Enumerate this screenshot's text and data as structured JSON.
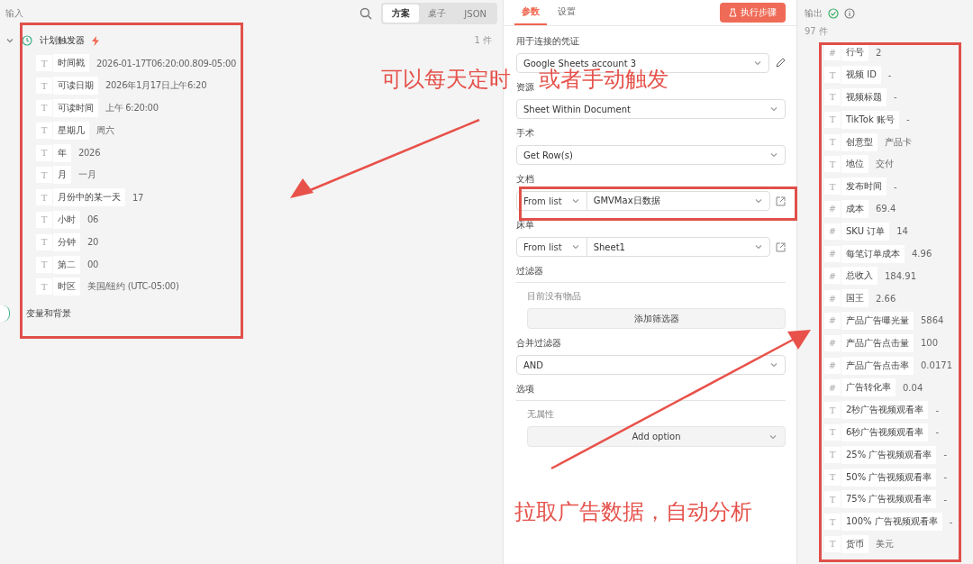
{
  "input_panel": {
    "title": "输入",
    "view_tabs": [
      {
        "label": "方案",
        "selected": true
      },
      {
        "label": "桌子",
        "selected": false
      },
      {
        "label": "JSON",
        "selected": false
      }
    ],
    "node": {
      "name": "计划触发器",
      "expanded": true,
      "count": "1 件",
      "fields": [
        {
          "glyph": "T",
          "key": "时间戳",
          "value": "2026-01-17T06:20:00.809-05:00"
        },
        {
          "glyph": "T",
          "key": "可读日期",
          "value": "2026年1月17日上午6:20"
        },
        {
          "glyph": "T",
          "key": "可读时间",
          "value": "上午 6:20:00"
        },
        {
          "glyph": "T",
          "key": "星期几",
          "value": "周六"
        },
        {
          "glyph": "T",
          "key": "年",
          "value": "2026"
        },
        {
          "glyph": "T",
          "key": "月",
          "value": "一月"
        },
        {
          "glyph": "T",
          "key": "月份中的某一天",
          "value": "17"
        },
        {
          "glyph": "T",
          "key": "小时",
          "value": "06"
        },
        {
          "glyph": "T",
          "key": "分钟",
          "value": "20"
        },
        {
          "glyph": "T",
          "key": "第二",
          "value": "00"
        },
        {
          "glyph": "T",
          "key": "时区",
          "value": "美国/纽约 (UTC-05:00)"
        }
      ]
    },
    "section": "变量和背景"
  },
  "params_panel": {
    "tabs": [
      {
        "label": "参数",
        "selected": true
      },
      {
        "label": "设置",
        "selected": false
      }
    ],
    "run_button": "执行步骤",
    "fields": [
      {
        "kind": "select",
        "label": "用于连接的凭证",
        "value": "Google Sheets account 3",
        "edit": true
      },
      {
        "kind": "select",
        "label": "资源",
        "value": "Sheet Within Document"
      },
      {
        "kind": "select",
        "label": "手术",
        "value": "Get Row(s)"
      },
      {
        "kind": "locator",
        "label": "文档",
        "mode": "From list",
        "value": "GMVMax日数据"
      },
      {
        "kind": "locator",
        "label": "床单",
        "mode": "From list",
        "value": "Sheet1"
      },
      {
        "kind": "collection",
        "label": "过滤器",
        "empty": "目前没有物品",
        "button": "添加筛选器"
      },
      {
        "kind": "select",
        "label": "合并过滤器",
        "value": "AND"
      },
      {
        "kind": "options",
        "label": "选项",
        "empty": "无属性",
        "button": "Add option"
      }
    ]
  },
  "output_panel": {
    "title": "输出",
    "count": "97 件",
    "fields": [
      {
        "glyph": "#",
        "key": "行号",
        "value": "2"
      },
      {
        "glyph": "T",
        "key": "视频 ID",
        "value": "-"
      },
      {
        "glyph": "T",
        "key": "视频标题",
        "value": "-"
      },
      {
        "glyph": "T",
        "key": "TikTok 账号",
        "value": "-"
      },
      {
        "glyph": "T",
        "key": "创意型",
        "value": "产品卡"
      },
      {
        "glyph": "T",
        "key": "地位",
        "value": "交付"
      },
      {
        "glyph": "T",
        "key": "发布时间",
        "value": "-"
      },
      {
        "glyph": "#",
        "key": "成本",
        "value": "69.4"
      },
      {
        "glyph": "#",
        "key": "SKU 订单",
        "value": "14"
      },
      {
        "glyph": "#",
        "key": "每笔订单成本",
        "value": "4.96"
      },
      {
        "glyph": "#",
        "key": "总收入",
        "value": "184.91"
      },
      {
        "glyph": "#",
        "key": "国王",
        "value": "2.66"
      },
      {
        "glyph": "#",
        "key": "产品广告曝光量",
        "value": "5864"
      },
      {
        "glyph": "#",
        "key": "产品广告点击量",
        "value": "100"
      },
      {
        "glyph": "#",
        "key": "产品广告点击率",
        "value": "0.0171"
      },
      {
        "glyph": "#",
        "key": "广告转化率",
        "value": "0.04"
      },
      {
        "glyph": "T",
        "key": "2秒广告视频观看率",
        "value": "-"
      },
      {
        "glyph": "T",
        "key": "6秒广告视频观看率",
        "value": "-"
      },
      {
        "glyph": "T",
        "key": "25% 广告视频观看率",
        "value": "-"
      },
      {
        "glyph": "T",
        "key": "50% 广告视频观看率",
        "value": "-"
      },
      {
        "glyph": "T",
        "key": "75% 广告视频观看率",
        "value": "-"
      },
      {
        "glyph": "T",
        "key": "100% 广告视频观看率",
        "value": "-"
      },
      {
        "glyph": "T",
        "key": "货币",
        "value": "美元"
      }
    ]
  },
  "annotations": [
    "可以每天定时",
    "或者手动触发",
    "拉取广告数据，自动分析"
  ]
}
